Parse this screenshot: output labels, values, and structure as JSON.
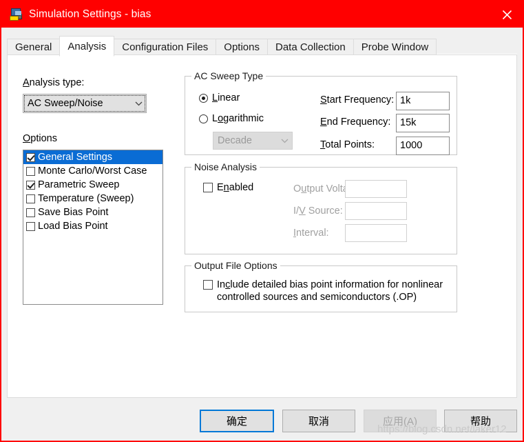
{
  "window": {
    "title": "Simulation Settings - bias",
    "icon": "simulation-profile-icon",
    "close_label": "✕",
    "titlebar_color": "#ff0000"
  },
  "tabs": [
    {
      "label": "General",
      "active": false
    },
    {
      "label": "Analysis",
      "active": true
    },
    {
      "label": "Configuration Files",
      "active": false
    },
    {
      "label": "Options",
      "active": false
    },
    {
      "label": "Data Collection",
      "active": false
    },
    {
      "label": "Probe Window",
      "active": false
    }
  ],
  "analysis": {
    "type_label": "Analysis type:",
    "type_label_accel": "A",
    "type_value": "AC Sweep/Noise",
    "options_label": "Options",
    "options_label_accel": "O",
    "options": [
      {
        "label": "General Settings",
        "checked": true,
        "selected": true
      },
      {
        "label": "Monte Carlo/Worst Case",
        "checked": false,
        "selected": false
      },
      {
        "label": "Parametric Sweep",
        "checked": true,
        "selected": false
      },
      {
        "label": "Temperature (Sweep)",
        "checked": false,
        "selected": false
      },
      {
        "label": "Save Bias Point",
        "checked": false,
        "selected": false
      },
      {
        "label": "Load Bias Point",
        "checked": false,
        "selected": false
      }
    ]
  },
  "ac_sweep": {
    "group_title": "AC Sweep Type",
    "linear_label": "Linear",
    "linear_accel": "L",
    "linear_selected": true,
    "logarithmic_label": "Logarithmic",
    "logarithmic_accel": "o",
    "logarithmic_selected": false,
    "scale_value": "Decade",
    "scale_disabled": true,
    "start_freq_label": "Start Frequency:",
    "start_freq_accel": "S",
    "start_freq_value": "1k",
    "end_freq_label": "End Frequency:",
    "end_freq_accel": "E",
    "end_freq_value": "15k",
    "total_points_label": "Total Points:",
    "total_points_accel": "T",
    "total_points_value": "1000"
  },
  "noise": {
    "group_title": "Noise Analysis",
    "enabled_label": "Enabled",
    "enabled_accel": "n",
    "enabled_checked": false,
    "output_voltage_label": "Output Voltage:",
    "output_voltage_accel": "u",
    "output_voltage_value": "",
    "iv_source_label": "I/V Source:",
    "iv_source_accel": "V",
    "iv_source_value": "",
    "interval_label": "Interval:",
    "interval_accel": "I",
    "interval_value": ""
  },
  "output_file": {
    "group_title": "Output File Options",
    "include_checked": false,
    "include_line1": "Include detailed bias point information for nonlinear",
    "include_line2": "controlled sources and semiconductors (.OP)",
    "include_accel": "c"
  },
  "footer": {
    "ok_label": "确定",
    "cancel_label": "取消",
    "apply_label": "应用(A)",
    "apply_disabled": true,
    "help_label": "帮助"
  },
  "watermark": "https://blog.csdn.net/laker12"
}
